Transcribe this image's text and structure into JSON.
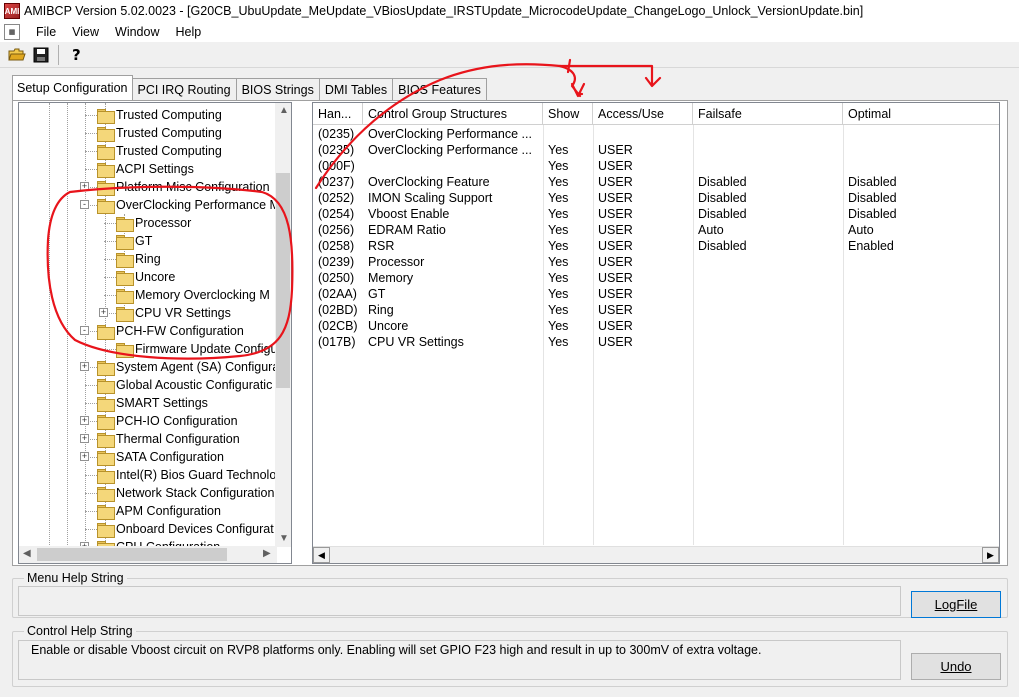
{
  "window": {
    "title": "AMIBCP Version 5.02.0023 - [G20CB_UbuUpdate_MeUpdate_VBiosUpdate_IRSTUpdate_MicrocodeUpdate_ChangeLogo_Unlock_VersionUpdate.bin]",
    "icon_label": "AMI"
  },
  "menu": {
    "items": [
      "File",
      "View",
      "Window",
      "Help"
    ]
  },
  "toolbar": {
    "icons": [
      "open-folder-icon",
      "save-disk-icon",
      "help-icon"
    ]
  },
  "tabs": [
    "Setup Configuration",
    "PCI IRQ Routing",
    "BIOS Strings",
    "DMI Tables",
    "BIOS Features"
  ],
  "tree": {
    "items": [
      {
        "label": "Trusted Computing",
        "level": 1,
        "expander": ""
      },
      {
        "label": "Trusted Computing",
        "level": 1,
        "expander": ""
      },
      {
        "label": "Trusted Computing",
        "level": 1,
        "expander": ""
      },
      {
        "label": "ACPI Settings",
        "level": 1,
        "expander": ""
      },
      {
        "label": "Platform Misc Configuration",
        "level": 1,
        "expander": "+"
      },
      {
        "label": "OverClocking Performance M",
        "level": 1,
        "expander": "-"
      },
      {
        "label": "Processor",
        "level": 2,
        "expander": ""
      },
      {
        "label": "GT",
        "level": 2,
        "expander": ""
      },
      {
        "label": "Ring",
        "level": 2,
        "expander": ""
      },
      {
        "label": "Uncore",
        "level": 2,
        "expander": ""
      },
      {
        "label": "Memory Overclocking M",
        "level": 2,
        "expander": ""
      },
      {
        "label": "CPU VR Settings",
        "level": 2,
        "expander": "+"
      },
      {
        "label": "PCH-FW Configuration",
        "level": 1,
        "expander": "-"
      },
      {
        "label": "Firmware Update Configu",
        "level": 2,
        "expander": ""
      },
      {
        "label": "System Agent (SA) Configura",
        "level": 1,
        "expander": "+"
      },
      {
        "label": "Global Acoustic Configuratic",
        "level": 1,
        "expander": ""
      },
      {
        "label": "SMART Settings",
        "level": 1,
        "expander": ""
      },
      {
        "label": "PCH-IO Configuration",
        "level": 1,
        "expander": "+"
      },
      {
        "label": "Thermal Configuration",
        "level": 1,
        "expander": "+"
      },
      {
        "label": "SATA Configuration",
        "level": 1,
        "expander": "+"
      },
      {
        "label": "Intel(R) Bios Guard Technolo",
        "level": 1,
        "expander": ""
      },
      {
        "label": "Network Stack Configuration",
        "level": 1,
        "expander": ""
      },
      {
        "label": "APM Configuration",
        "level": 1,
        "expander": ""
      },
      {
        "label": "Onboard Devices Configurat",
        "level": 1,
        "expander": ""
      },
      {
        "label": "CPU Configuration",
        "level": 1,
        "expander": "+"
      }
    ]
  },
  "grid": {
    "columns": [
      "Han...",
      "Control Group Structures",
      "Show",
      "Access/Use",
      "Failsafe",
      "Optimal"
    ],
    "rows": [
      [
        "(0235)",
        "OverClocking Performance ...",
        "",
        "",
        "",
        ""
      ],
      [
        "(0235)",
        "OverClocking Performance ...",
        "Yes",
        "USER",
        "",
        ""
      ],
      [
        "(000F)",
        "",
        "Yes",
        "USER",
        "",
        ""
      ],
      [
        "(0237)",
        "OverClocking Feature",
        "Yes",
        "USER",
        "Disabled",
        "Disabled"
      ],
      [
        "(0252)",
        "IMON Scaling Support",
        "Yes",
        "USER",
        "Disabled",
        "Disabled"
      ],
      [
        "(0254)",
        "Vboost Enable",
        "Yes",
        "USER",
        "Disabled",
        "Disabled"
      ],
      [
        "(0256)",
        "EDRAM Ratio",
        "Yes",
        "USER",
        "Auto",
        "Auto"
      ],
      [
        "(0258)",
        "RSR",
        "Yes",
        "USER",
        "Disabled",
        "Enabled"
      ],
      [
        "(0239)",
        "Processor",
        "Yes",
        "USER",
        "",
        ""
      ],
      [
        "(0250)",
        "Memory",
        "Yes",
        "USER",
        "",
        ""
      ],
      [
        "(02AA)",
        "GT",
        "Yes",
        "USER",
        "",
        ""
      ],
      [
        "(02BD)",
        "Ring",
        "Yes",
        "USER",
        "",
        ""
      ],
      [
        "(02CB)",
        "Uncore",
        "Yes",
        "USER",
        "",
        ""
      ],
      [
        "(017B)",
        "CPU VR Settings",
        "Yes",
        "USER",
        "",
        ""
      ]
    ]
  },
  "help": {
    "menu_legend": "Menu Help String",
    "menu_text": "",
    "control_legend": "Control Help String",
    "control_text": "Enable or disable Vboost circuit on RVP8 platforms only. Enabling will set GPIO F23 high and result in up to 300mV of extra voltage."
  },
  "buttons": {
    "logfile": "LogFile",
    "undo": "Undo"
  },
  "colors": {
    "annotation": "#e8141b"
  }
}
